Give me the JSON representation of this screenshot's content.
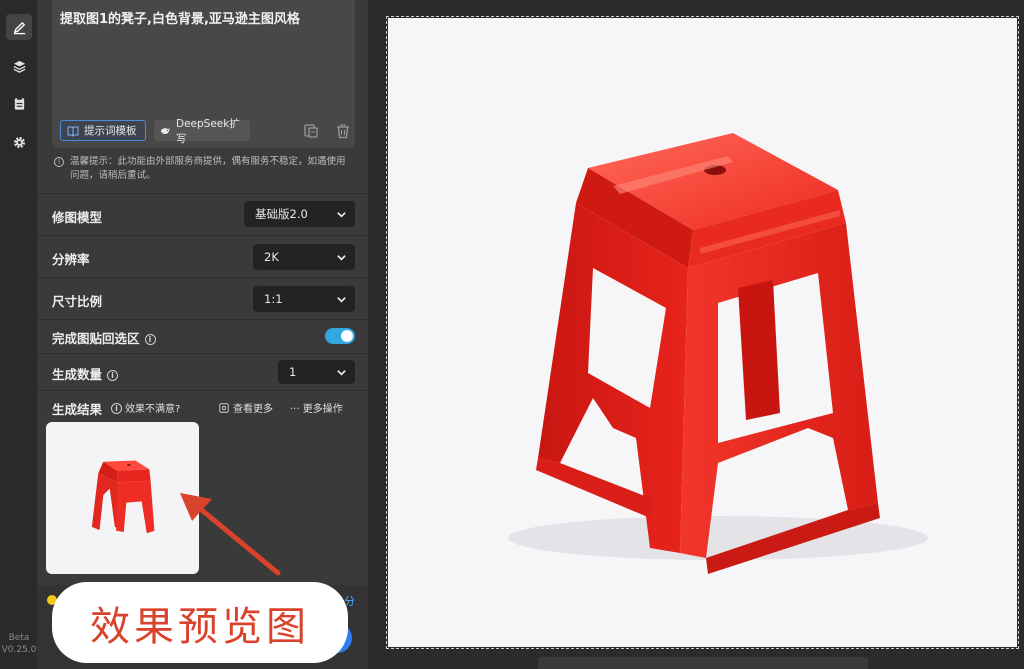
{
  "prompt": {
    "text": "提取图1的凳子,白色背景,亚马逊主图风格",
    "template_button": "提示词模板",
    "deepseek_button": "DeepSeek扩写"
  },
  "notice": "温馨提示：此功能由外部服务商提供，偶有服务不稳定，如遇使用问题，请稍后重试。",
  "settings": {
    "model": {
      "label": "修图模型",
      "value": "基础版2.0"
    },
    "resolution": {
      "label": "分辨率",
      "value": "2K"
    },
    "ratio": {
      "label": "尺寸比例",
      "value": "1:1"
    },
    "paste_back": {
      "label": "完成图贴回选区",
      "enabled": true
    },
    "count": {
      "label": "生成数量",
      "value": "1"
    }
  },
  "result": {
    "label": "生成结果",
    "unsatisfied": "效果不满意?",
    "view_more": "查看更多",
    "more_ops": "··· 更多操作"
  },
  "credits_fragment": "分",
  "version": {
    "tag": "Beta",
    "number": "V0.25.0"
  },
  "annotation": "效果预览图",
  "colors": {
    "accent": "#2fa8e0",
    "annotation_red": "#d9422b",
    "stool_red": "#e8251f"
  },
  "icons": [
    "pen-icon",
    "layers-icon",
    "clipboard-icon",
    "gear-icon",
    "book-icon",
    "whale-icon",
    "copy-icon",
    "trash-icon",
    "info-icon",
    "chevron-down-icon",
    "search-icon"
  ]
}
